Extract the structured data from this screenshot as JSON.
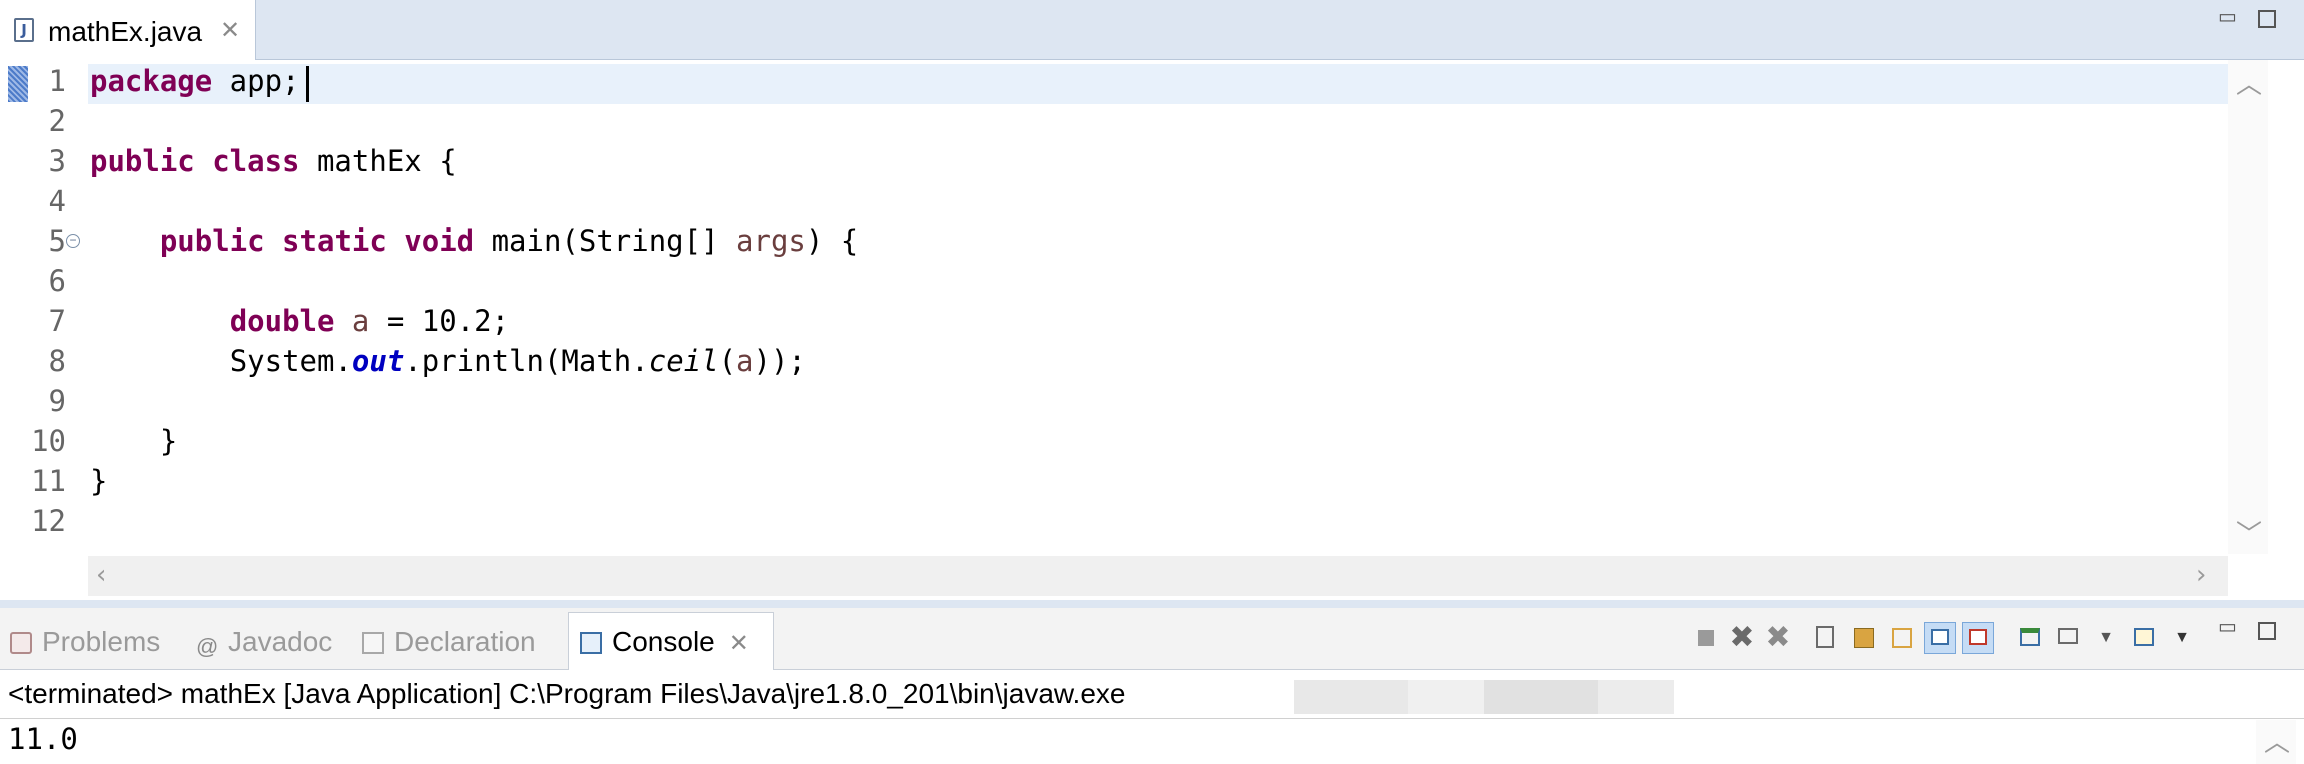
{
  "editor": {
    "tab_label": "mathEx.java",
    "line_numbers": [
      "1",
      "2",
      "3",
      "4",
      "5",
      "6",
      "7",
      "8",
      "9",
      "10",
      "11",
      "12"
    ],
    "code": {
      "l1_kw": "package",
      "l1_rest": " app;",
      "l3_kw": "public class",
      "l3_rest": " mathEx {",
      "l5_indent": "    ",
      "l5_kw": "public static void",
      "l5_mid": " main(String[] ",
      "l5_var": "args",
      "l5_end": ") {",
      "l7_indent": "        ",
      "l7_kw": "double",
      "l7_sp": " ",
      "l7_var": "a",
      "l7_rest": " = 10.2;",
      "l8_indent": "        ",
      "l8_a": "System.",
      "l8_field": "out",
      "l8_b": ".println(Math.",
      "l8_static": "ceil",
      "l8_c": "(",
      "l8_var": "a",
      "l8_d": "));",
      "l10": "    }",
      "l11": "}"
    }
  },
  "console_view": {
    "tabs": [
      "Problems",
      "Javadoc",
      "Declaration",
      "Console"
    ],
    "status": "<terminated> mathEx [Java Application] C:\\Program Files\\Java\\jre1.8.0_201\\bin\\javaw.exe",
    "output": "11.0"
  },
  "colors": {
    "keyword": "#7f0055",
    "local_var": "#6a3e3e",
    "field": "#0000c0",
    "tab_bar": "#dde6f2",
    "current_line": "#e8f1fb"
  }
}
